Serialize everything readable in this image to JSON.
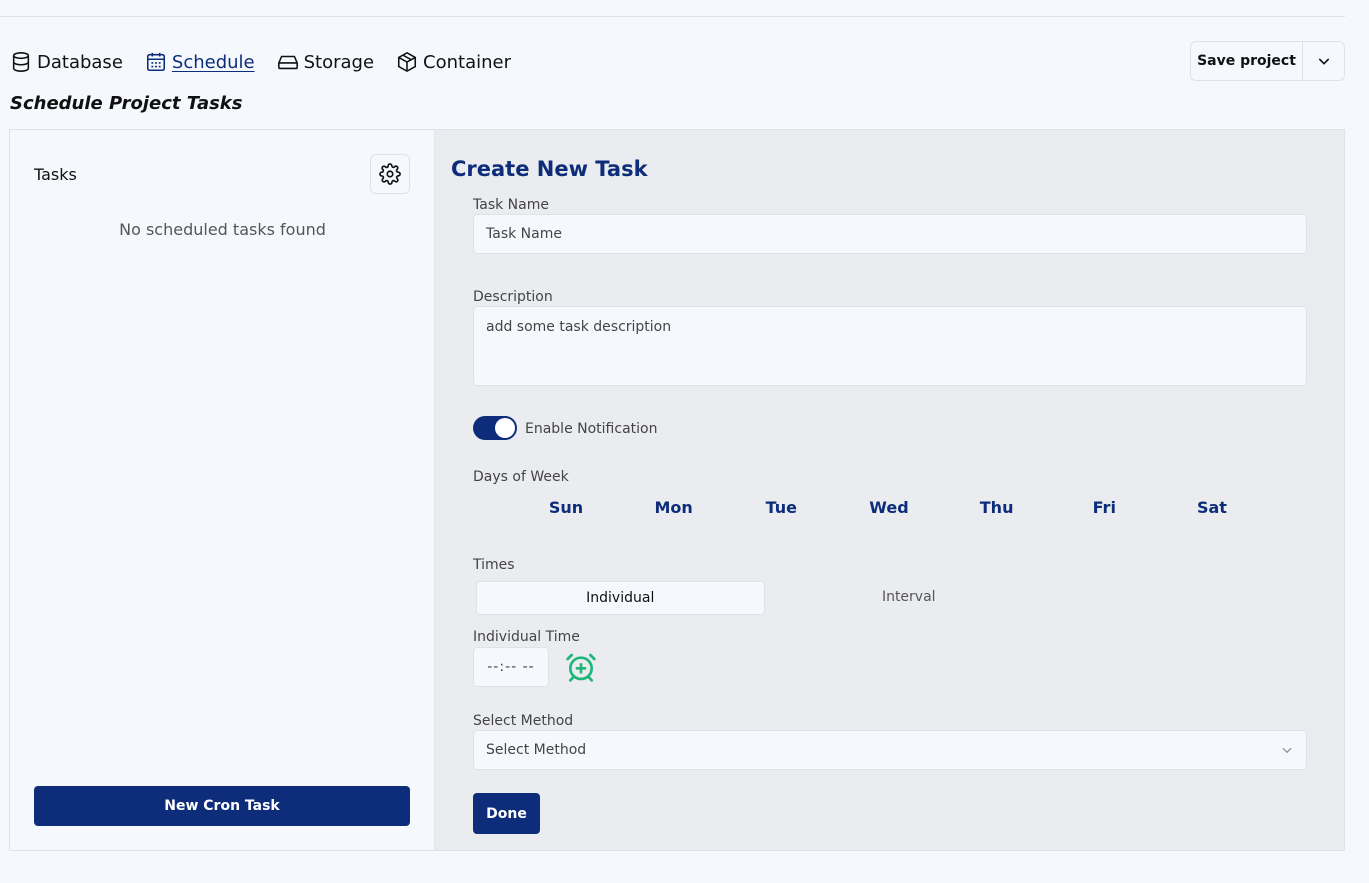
{
  "nav": {
    "items": [
      {
        "label": "Database",
        "icon": "database-icon"
      },
      {
        "label": "Schedule",
        "icon": "calendar-icon",
        "active": true
      },
      {
        "label": "Storage",
        "icon": "hard-drive-icon"
      },
      {
        "label": "Container",
        "icon": "box-icon"
      }
    ]
  },
  "header": {
    "save_label": "Save project",
    "dropdown_icon": "chevron-down-icon"
  },
  "page_title": "Schedule Project Tasks",
  "tasks_panel": {
    "title": "Tasks",
    "settings_icon": "gear-icon",
    "empty_text": "No scheduled tasks found",
    "new_button": "New Cron Task"
  },
  "form": {
    "title": "Create New Task",
    "task_name": {
      "label": "Task Name",
      "placeholder": "Task Name",
      "value": ""
    },
    "description": {
      "label": "Description",
      "placeholder": "add some task description",
      "value": ""
    },
    "notification": {
      "label": "Enable Notification",
      "enabled": true
    },
    "days": {
      "label": "Days of Week",
      "items": [
        "Sun",
        "Mon",
        "Tue",
        "Wed",
        "Thu",
        "Fri",
        "Sat"
      ]
    },
    "times": {
      "label": "Times",
      "options": [
        "Individual",
        "Interval"
      ],
      "selected": "Individual"
    },
    "individual_time": {
      "label": "Individual Time",
      "placeholder": "--:-- --",
      "add_icon": "alarm-plus-icon"
    },
    "method": {
      "label": "Select Method",
      "selected": "Select Method"
    },
    "done_label": "Done"
  },
  "colors": {
    "primary": "#0d2d7a",
    "accent_green": "#1fb67a",
    "background": "#f5f9fd",
    "panel_right": "#eaecef"
  }
}
